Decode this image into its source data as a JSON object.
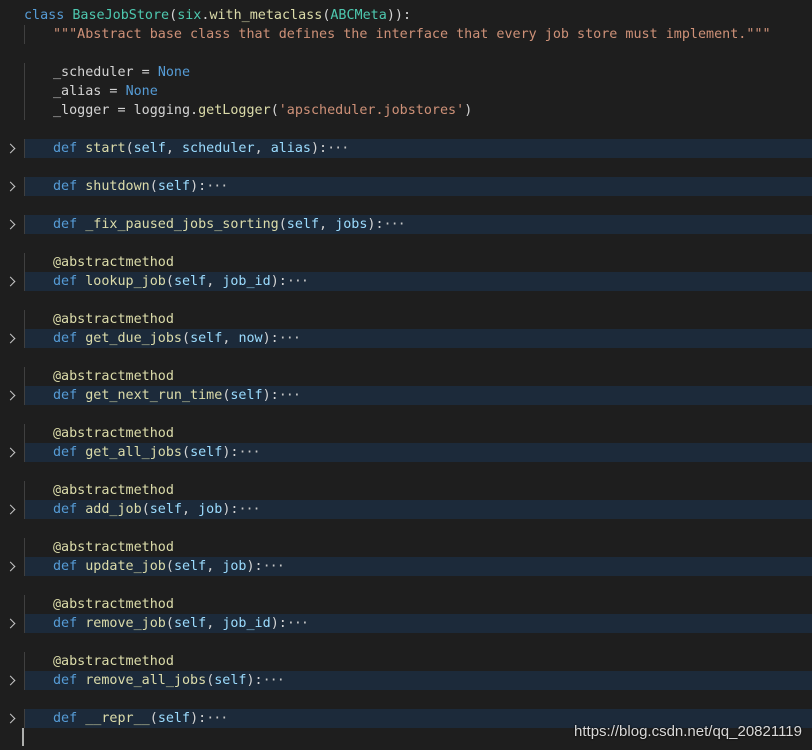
{
  "editor": {
    "lines": [
      {
        "type": "class",
        "parts": [
          [
            "kw",
            "class "
          ],
          [
            "cls",
            "BaseJobStore"
          ],
          [
            "plain",
            "("
          ],
          [
            "cls",
            "six"
          ],
          [
            "plain",
            "."
          ],
          [
            "fn",
            "with_metaclass"
          ],
          [
            "plain",
            "("
          ],
          [
            "cls",
            "ABCMeta"
          ],
          [
            "plain",
            "))"
          ],
          [
            "plain",
            ":"
          ]
        ]
      },
      {
        "type": "doc",
        "indent": 1,
        "parts": [
          [
            "str",
            "\"\"\"Abstract base class that defines the interface that every job store must implement.\"\"\""
          ]
        ]
      },
      {
        "type": "blank"
      },
      {
        "type": "code",
        "indent": 1,
        "parts": [
          [
            "plain",
            "_scheduler = "
          ],
          [
            "const",
            "None"
          ]
        ]
      },
      {
        "type": "code",
        "indent": 1,
        "parts": [
          [
            "plain",
            "_alias = "
          ],
          [
            "const",
            "None"
          ]
        ]
      },
      {
        "type": "code",
        "indent": 1,
        "parts": [
          [
            "plain",
            "_logger = logging."
          ],
          [
            "fn",
            "getLogger"
          ],
          [
            "plain",
            "("
          ],
          [
            "str",
            "'apscheduler.jobstores'"
          ],
          [
            "plain",
            ")"
          ]
        ]
      },
      {
        "type": "blank"
      },
      {
        "type": "fold",
        "indent": 1,
        "parts": [
          [
            "kw",
            "def "
          ],
          [
            "fn",
            "start"
          ],
          [
            "plain",
            "("
          ],
          [
            "param",
            "self"
          ],
          [
            "plain",
            ", "
          ],
          [
            "param",
            "scheduler"
          ],
          [
            "plain",
            ", "
          ],
          [
            "param",
            "alias"
          ],
          [
            "plain",
            "):"
          ],
          [
            "ellipsis",
            "···"
          ]
        ]
      },
      {
        "type": "blank"
      },
      {
        "type": "fold",
        "indent": 1,
        "parts": [
          [
            "kw",
            "def "
          ],
          [
            "fn",
            "shutdown"
          ],
          [
            "plain",
            "("
          ],
          [
            "param",
            "self"
          ],
          [
            "plain",
            "):"
          ],
          [
            "ellipsis",
            "···"
          ]
        ]
      },
      {
        "type": "blank"
      },
      {
        "type": "fold",
        "indent": 1,
        "parts": [
          [
            "kw",
            "def "
          ],
          [
            "fn",
            "_fix_paused_jobs_sorting"
          ],
          [
            "plain",
            "("
          ],
          [
            "param",
            "self"
          ],
          [
            "plain",
            ", "
          ],
          [
            "param",
            "jobs"
          ],
          [
            "plain",
            "):"
          ],
          [
            "ellipsis",
            "···"
          ]
        ]
      },
      {
        "type": "blank"
      },
      {
        "type": "code",
        "indent": 1,
        "parts": [
          [
            "dec",
            "@abstractmethod"
          ]
        ]
      },
      {
        "type": "fold",
        "indent": 1,
        "parts": [
          [
            "kw",
            "def "
          ],
          [
            "fn",
            "lookup_job"
          ],
          [
            "plain",
            "("
          ],
          [
            "param",
            "self"
          ],
          [
            "plain",
            ", "
          ],
          [
            "param",
            "job_id"
          ],
          [
            "plain",
            "):"
          ],
          [
            "ellipsis",
            "···"
          ]
        ]
      },
      {
        "type": "blank"
      },
      {
        "type": "code",
        "indent": 1,
        "parts": [
          [
            "dec",
            "@abstractmethod"
          ]
        ]
      },
      {
        "type": "fold",
        "indent": 1,
        "parts": [
          [
            "kw",
            "def "
          ],
          [
            "fn",
            "get_due_jobs"
          ],
          [
            "plain",
            "("
          ],
          [
            "param",
            "self"
          ],
          [
            "plain",
            ", "
          ],
          [
            "param",
            "now"
          ],
          [
            "plain",
            "):"
          ],
          [
            "ellipsis",
            "···"
          ]
        ]
      },
      {
        "type": "blank"
      },
      {
        "type": "code",
        "indent": 1,
        "parts": [
          [
            "dec",
            "@abstractmethod"
          ]
        ]
      },
      {
        "type": "fold",
        "indent": 1,
        "parts": [
          [
            "kw",
            "def "
          ],
          [
            "fn",
            "get_next_run_time"
          ],
          [
            "plain",
            "("
          ],
          [
            "param",
            "self"
          ],
          [
            "plain",
            "):"
          ],
          [
            "ellipsis",
            "···"
          ]
        ]
      },
      {
        "type": "blank"
      },
      {
        "type": "code",
        "indent": 1,
        "parts": [
          [
            "dec",
            "@abstractmethod"
          ]
        ]
      },
      {
        "type": "fold",
        "indent": 1,
        "parts": [
          [
            "kw",
            "def "
          ],
          [
            "fn",
            "get_all_jobs"
          ],
          [
            "plain",
            "("
          ],
          [
            "param",
            "self"
          ],
          [
            "plain",
            "):"
          ],
          [
            "ellipsis",
            "···"
          ]
        ]
      },
      {
        "type": "blank"
      },
      {
        "type": "code",
        "indent": 1,
        "parts": [
          [
            "dec",
            "@abstractmethod"
          ]
        ]
      },
      {
        "type": "fold",
        "indent": 1,
        "parts": [
          [
            "kw",
            "def "
          ],
          [
            "fn",
            "add_job"
          ],
          [
            "plain",
            "("
          ],
          [
            "param",
            "self"
          ],
          [
            "plain",
            ", "
          ],
          [
            "param",
            "job"
          ],
          [
            "plain",
            "):"
          ],
          [
            "ellipsis",
            "···"
          ]
        ]
      },
      {
        "type": "blank"
      },
      {
        "type": "code",
        "indent": 1,
        "parts": [
          [
            "dec",
            "@abstractmethod"
          ]
        ]
      },
      {
        "type": "fold",
        "indent": 1,
        "parts": [
          [
            "kw",
            "def "
          ],
          [
            "fn",
            "update_job"
          ],
          [
            "plain",
            "("
          ],
          [
            "param",
            "self"
          ],
          [
            "plain",
            ", "
          ],
          [
            "param",
            "job"
          ],
          [
            "plain",
            "):"
          ],
          [
            "ellipsis",
            "···"
          ]
        ]
      },
      {
        "type": "blank"
      },
      {
        "type": "code",
        "indent": 1,
        "parts": [
          [
            "dec",
            "@abstractmethod"
          ]
        ]
      },
      {
        "type": "fold",
        "indent": 1,
        "parts": [
          [
            "kw",
            "def "
          ],
          [
            "fn",
            "remove_job"
          ],
          [
            "plain",
            "("
          ],
          [
            "param",
            "self"
          ],
          [
            "plain",
            ", "
          ],
          [
            "param",
            "job_id"
          ],
          [
            "plain",
            "):"
          ],
          [
            "ellipsis",
            "···"
          ]
        ]
      },
      {
        "type": "blank"
      },
      {
        "type": "code",
        "indent": 1,
        "parts": [
          [
            "dec",
            "@abstractmethod"
          ]
        ]
      },
      {
        "type": "fold",
        "indent": 1,
        "parts": [
          [
            "kw",
            "def "
          ],
          [
            "fn",
            "remove_all_jobs"
          ],
          [
            "plain",
            "("
          ],
          [
            "param",
            "self"
          ],
          [
            "plain",
            "):"
          ],
          [
            "ellipsis",
            "···"
          ]
        ]
      },
      {
        "type": "blank"
      },
      {
        "type": "fold",
        "indent": 1,
        "parts": [
          [
            "kw",
            "def "
          ],
          [
            "fn",
            "__repr__"
          ],
          [
            "plain",
            "("
          ],
          [
            "param",
            "self"
          ],
          [
            "plain",
            "):"
          ],
          [
            "ellipsis",
            "···"
          ]
        ]
      },
      {
        "type": "cursor"
      }
    ]
  },
  "watermark": {
    "text": "https://blog.csdn.net/qq_20821119"
  },
  "icons": {
    "fold": "chevron-right-icon"
  },
  "colors": {
    "background": "#1e1e1e",
    "keyword": "#569cd6",
    "class": "#4ec9b0",
    "function": "#dcdcaa",
    "string": "#ce9178",
    "parameter": "#9cdcfe",
    "folded_highlight": "#1c2a3a"
  }
}
